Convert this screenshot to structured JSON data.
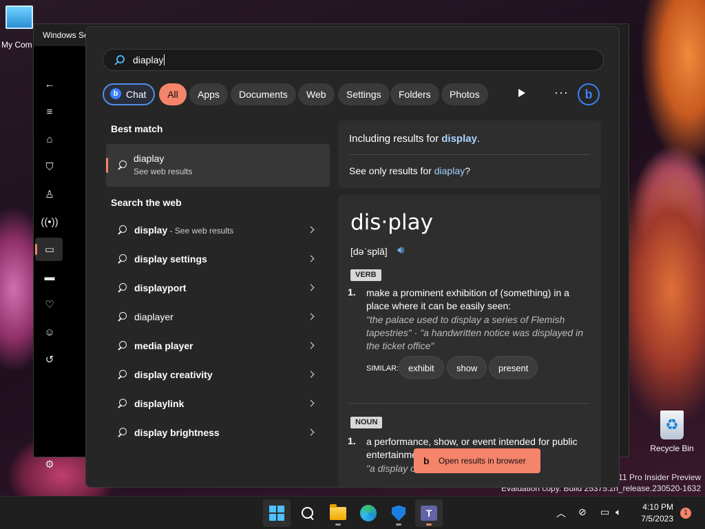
{
  "desktop": {
    "my_computer_label": "My Com",
    "recycle_bin_label": "Recycle Bin",
    "watermark_line1": "s 11 Pro Insider Preview",
    "watermark_line2": "Evaluation copy. Build 25375.zn_release.230520-1632"
  },
  "background_window": {
    "title": "Windows Se"
  },
  "search": {
    "query": "diaplay"
  },
  "filters": {
    "chat": "Chat",
    "items": [
      "All",
      "Apps",
      "Documents",
      "Web",
      "Settings",
      "Folders",
      "Photos"
    ],
    "active": "All",
    "more": "···"
  },
  "best_match": {
    "section": "Best match",
    "title": "diaplay",
    "subtitle": "See web results"
  },
  "search_web": {
    "section": "Search the web",
    "items": [
      {
        "text": "display",
        "hint": " - See web results"
      },
      {
        "text": "display settings",
        "hint": ""
      },
      {
        "text": "displayport",
        "hint": ""
      },
      {
        "text": "diaplayer",
        "hint": ""
      },
      {
        "text": "media player",
        "hint": ""
      },
      {
        "text": "display creativity",
        "hint": ""
      },
      {
        "text": "displaylink",
        "hint": ""
      },
      {
        "text": "display brightness",
        "hint": ""
      }
    ]
  },
  "correction": {
    "including_prefix": "Including results for ",
    "corrected": "display",
    "including_suffix": ".",
    "only_prefix": "See only results for ",
    "original": "diaplay",
    "only_suffix": "?"
  },
  "dictionary": {
    "word": "dis·play",
    "pronunciation": "[dəˈsplā]",
    "verb_label": "VERB",
    "verb_num": "1.",
    "verb_def": "make a prominent exhibition of (something) in a place where it can be easily seen:",
    "verb_example": "\"the palace used to display a series of Flemish tapestries\" · \"a handwritten notice was displayed in the ticket office\"",
    "similar_label": "SIMILAR:",
    "similar": [
      "exhibit",
      "show",
      "present"
    ],
    "noun_label": "NOUN",
    "noun_num": "1.",
    "noun_def": "a performance, show, or event intended for public entertainment",
    "noun_example": "\"a display of"
  },
  "open_browser": {
    "label": "Open results in browser"
  },
  "taskbar": {
    "time": "4:10 PM",
    "date": "7/5/2023",
    "notifications": "1"
  }
}
